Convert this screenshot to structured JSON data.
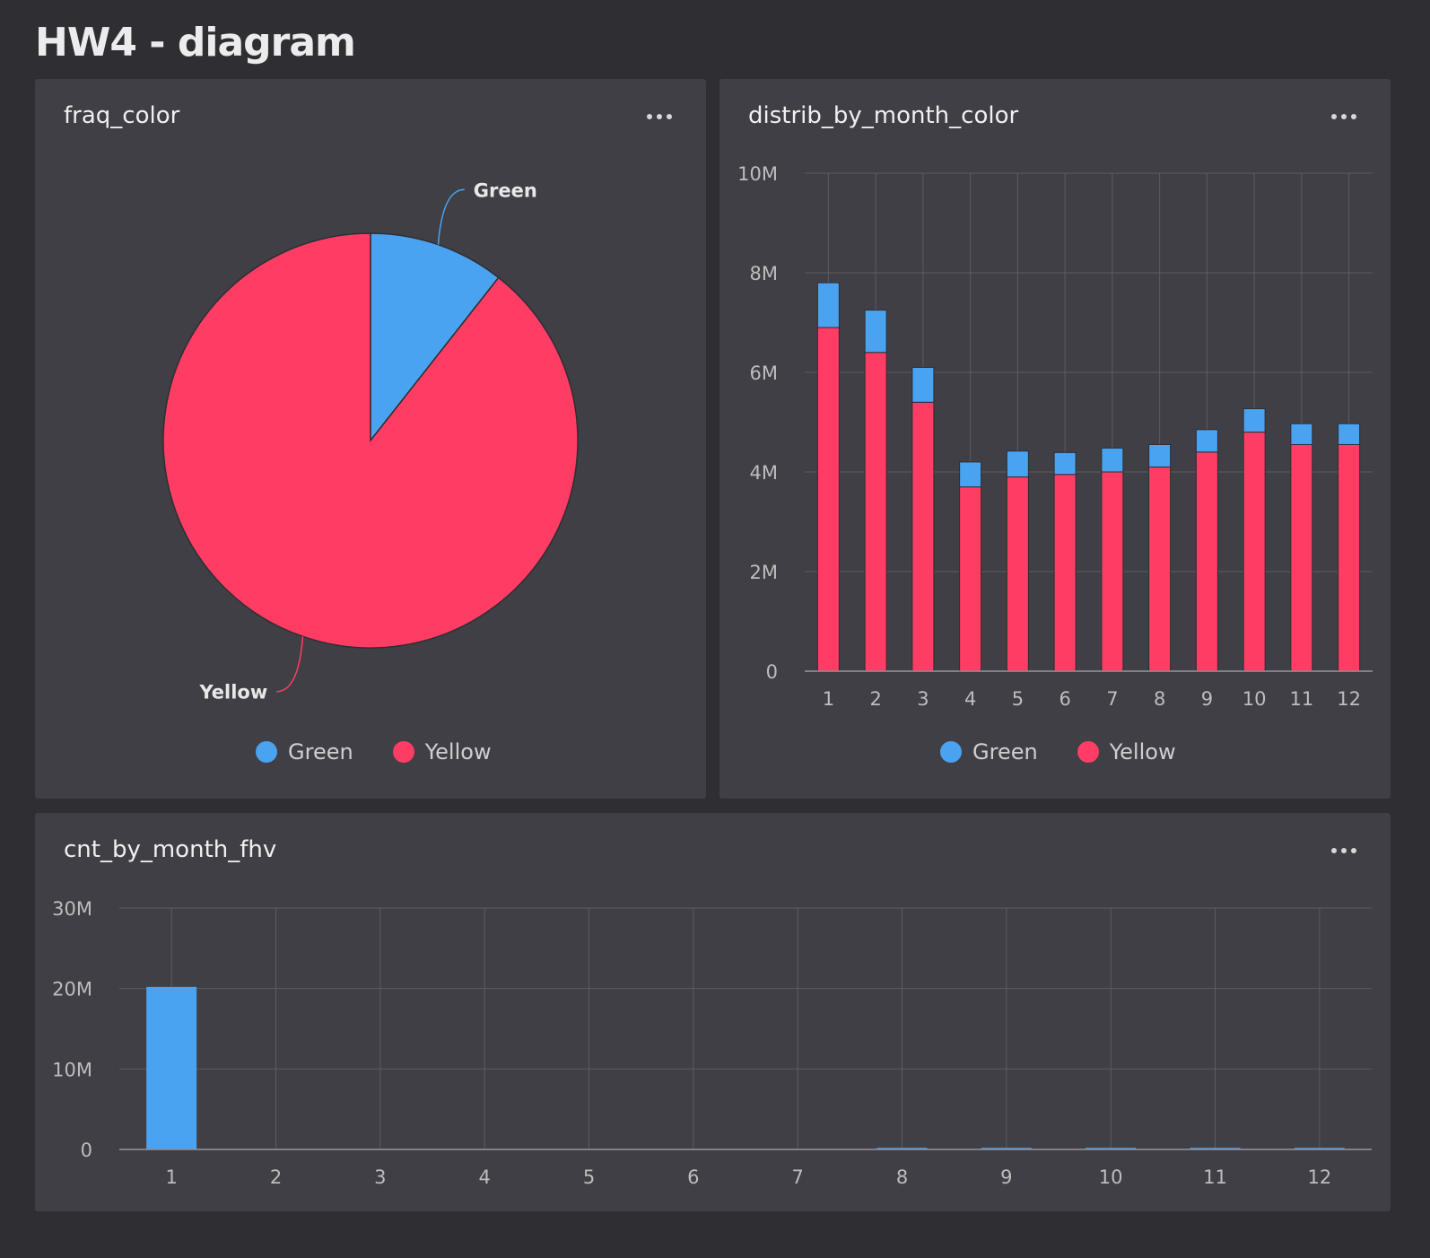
{
  "dashboard": {
    "title": "HW4 - diagram"
  },
  "colors": {
    "green": "#4aa3f0",
    "yellow": "#ff3d64"
  },
  "panels": {
    "fraq_color": {
      "title": "fraq_color"
    },
    "distrib_by_month_color": {
      "title": "distrib_by_month_color"
    },
    "cnt_by_month_fhv": {
      "title": "cnt_by_month_fhv"
    }
  },
  "chart_data": [
    {
      "type": "pie",
      "title": "fraq_color",
      "labels": [
        "Green",
        "Yellow"
      ],
      "values": [
        10.6,
        89.4
      ],
      "colors": [
        "#4aa3f0",
        "#ff3d64"
      ],
      "legend": [
        "Green",
        "Yellow"
      ],
      "legend_position": "bottom"
    },
    {
      "type": "bar",
      "stacked": true,
      "title": "distrib_by_month_color",
      "categories": [
        "1",
        "2",
        "3",
        "4",
        "5",
        "6",
        "7",
        "8",
        "9",
        "10",
        "11",
        "12"
      ],
      "series": [
        {
          "name": "Yellow",
          "color": "#ff3d64",
          "values": [
            6900000,
            6400000,
            5400000,
            3700000,
            3900000,
            3950000,
            4000000,
            4100000,
            4400000,
            4800000,
            4550000,
            4550000
          ]
        },
        {
          "name": "Green",
          "color": "#4aa3f0",
          "values": [
            900000,
            850000,
            700000,
            500000,
            520000,
            440000,
            480000,
            450000,
            450000,
            470000,
            420000,
            420000
          ]
        }
      ],
      "ylim": [
        0,
        10000000
      ],
      "yticks": [
        0,
        2000000,
        4000000,
        6000000,
        8000000,
        10000000
      ],
      "ytick_labels": [
        "0",
        "2M",
        "4M",
        "6M",
        "8M",
        "10M"
      ],
      "grid": true,
      "legend": [
        "Green",
        "Yellow"
      ],
      "legend_position": "bottom"
    },
    {
      "type": "bar",
      "title": "cnt_by_month_fhv",
      "categories": [
        "1",
        "2",
        "3",
        "4",
        "5",
        "6",
        "7",
        "8",
        "9",
        "10",
        "11",
        "12"
      ],
      "series": [
        {
          "name": "fhv",
          "color": "#4aa3f0",
          "values": [
            20200000,
            0,
            0,
            0,
            0,
            0,
            0,
            200000,
            200000,
            200000,
            200000,
            200000
          ]
        }
      ],
      "ylim": [
        0,
        30000000
      ],
      "yticks": [
        0,
        10000000,
        20000000,
        30000000
      ],
      "ytick_labels": [
        "0",
        "10M",
        "20M",
        "30M"
      ],
      "grid": true
    }
  ]
}
